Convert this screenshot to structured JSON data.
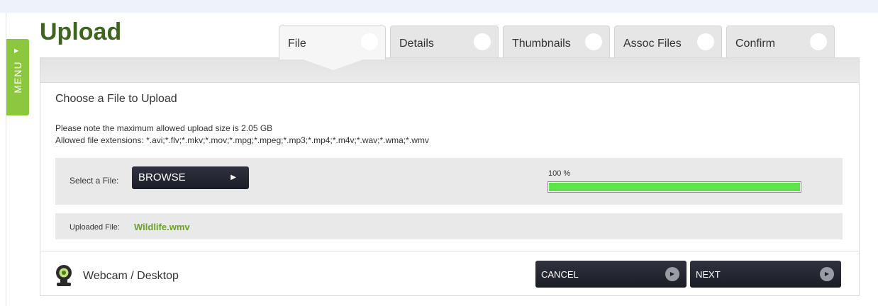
{
  "menu": {
    "label": "MENU"
  },
  "page": {
    "title": "Upload"
  },
  "tabs": [
    {
      "label": "File"
    },
    {
      "label": "Details"
    },
    {
      "label": "Thumbnails"
    },
    {
      "label": "Assoc Files"
    },
    {
      "label": "Confirm"
    }
  ],
  "upload": {
    "section_title": "Choose a File to Upload",
    "note_size": "Please note the maximum allowed upload size is 2.05 GB",
    "note_extensions": "Allowed file extensions: *.avi;*.flv;*.mkv;*.mov;*.mpg;*.mpeg;*.mp3;*.mp4;*.m4v;*.wav;*.wma;*.wmv",
    "select_label": "Select a File:",
    "browse_label": "BROWSE",
    "progress_text": "100 %",
    "progress_fraction": 1.0,
    "uploaded_label": "Uploaded File:",
    "uploaded_file": "Wildlife.wmv"
  },
  "footer": {
    "webcam_label": "Webcam / Desktop",
    "cancel_label": "CANCEL",
    "next_label": "NEXT"
  },
  "icons": {
    "menu_arrow": "caret-right-icon",
    "tab_indicator": "circle-indicator-icon",
    "browse": "play-icon",
    "webcam": "webcam-icon",
    "button_play": "play-circle-icon"
  },
  "colors": {
    "brand_green": "#8dc63f",
    "title_green": "#3e6420",
    "file_green": "#6aa124",
    "progress_green": "#5ee34a",
    "button_dark": "#1b1d26"
  }
}
